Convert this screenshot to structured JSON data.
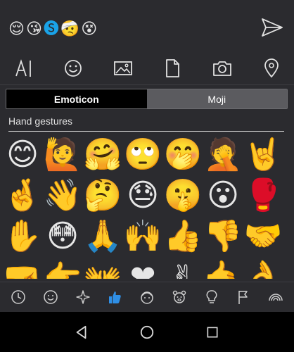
{
  "compose": {
    "recent_emoji": [
      "😌",
      "😘",
      "🅢",
      "🤕",
      "😵"
    ],
    "send_icon": "send-icon"
  },
  "toolbar": {
    "items": [
      "text-format-icon",
      "emoticon-icon",
      "image-icon",
      "file-icon",
      "camera-icon",
      "location-icon"
    ]
  },
  "tabs": [
    {
      "label": "Emoticon",
      "active": true
    },
    {
      "label": "Moji",
      "active": false
    }
  ],
  "section": {
    "title": "Hand gestures"
  },
  "emoji_grid": [
    [
      "😊",
      "🙋",
      "🤗",
      "🙄",
      "🤭",
      "🤦",
      "🤘"
    ],
    [
      "🤞",
      "👋",
      "🤔",
      "😓",
      "🤫",
      "😮",
      "🥊"
    ],
    [
      "✋",
      "😳",
      "🙏",
      "🙌",
      "👍",
      "👎",
      "🤝"
    ],
    [
      "🤜",
      "👉",
      "👐",
      "❤",
      "✌",
      "🤙",
      "👌"
    ]
  ],
  "categories": {
    "items": [
      "recent-icon",
      "smiley-icon",
      "sparkle-icon",
      "thumbs-up-icon",
      "face-icon",
      "animal-icon",
      "bulb-icon",
      "flag-icon",
      "rainbow-icon"
    ],
    "active_index": 3,
    "accent": "#2f8fe6"
  },
  "navbar": {
    "items": [
      "back-icon",
      "home-icon",
      "recents-icon"
    ]
  }
}
